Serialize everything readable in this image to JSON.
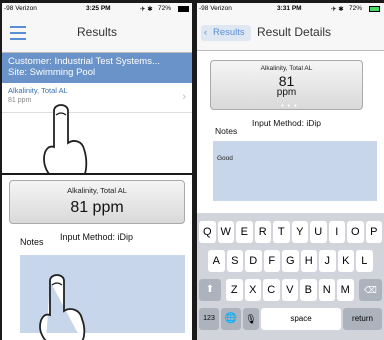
{
  "left": {
    "status": {
      "carrier": "-98 Verizon",
      "time": "3:25 PM",
      "battery": "72%"
    },
    "nav": {
      "title": "Results"
    },
    "banner": {
      "line1": "Customer: Industrial Test Systems...",
      "line2": "Site: Swimming Pool"
    },
    "row": {
      "title": "Alkalinity, Total AL",
      "value": "81 ppm"
    },
    "detail": {
      "card_title": "Alkalinity, Total AL",
      "card_value": "81 ppm",
      "notes_label": "Notes",
      "method": "Input Method: iDip"
    }
  },
  "right": {
    "status": {
      "carrier": "-98 Verizon",
      "time": "3:31 PM",
      "battery": "72%"
    },
    "nav": {
      "back": "Results",
      "title": "Result Details"
    },
    "card": {
      "title": "Alkalinity, Total AL",
      "value": "81",
      "unit": "ppm"
    },
    "notes_label": "Notes",
    "method": "Input Method: iDip",
    "notes_text": "Good",
    "keyboard": {
      "row1": [
        "Q",
        "W",
        "E",
        "R",
        "T",
        "Y",
        "U",
        "I",
        "O",
        "P"
      ],
      "row2": [
        "A",
        "S",
        "D",
        "F",
        "G",
        "H",
        "J",
        "K",
        "L"
      ],
      "row3": [
        "Z",
        "X",
        "C",
        "V",
        "B",
        "N",
        "M"
      ],
      "num": "123",
      "space": "space",
      "return": "return"
    }
  },
  "colors": {
    "ios_blue": "#5a8fd6",
    "banner": "#6a93c9",
    "notes_bg": "#c7d6ea"
  }
}
